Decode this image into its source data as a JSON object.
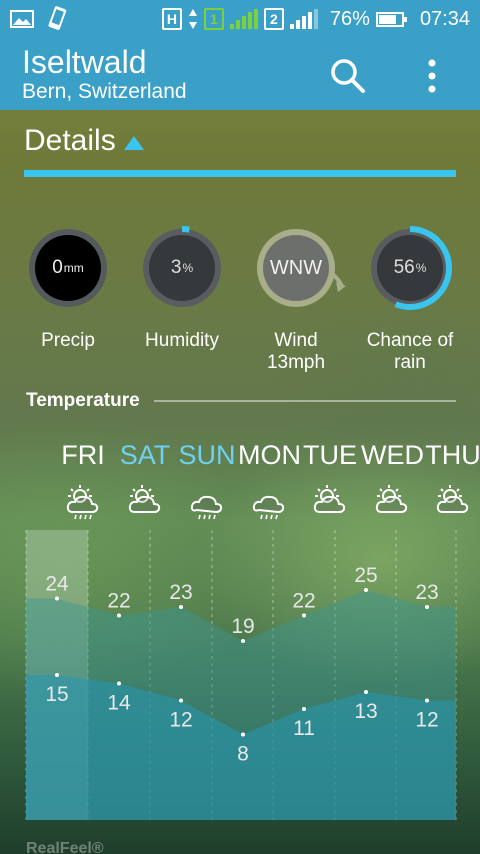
{
  "status": {
    "battery": "76%",
    "time": "07:34",
    "sim1": "1",
    "sim2": "2",
    "net": "H"
  },
  "location": {
    "city": "Iseltwald",
    "region": "Bern, Switzerland"
  },
  "section": {
    "title": "Details"
  },
  "metrics": [
    {
      "label": "Precip",
      "value": "0",
      "unit": "mm",
      "fraction": 0
    },
    {
      "label": "Humidity",
      "value": "3",
      "unit": "%",
      "fraction": 0.03
    },
    {
      "label": "Wind\n13mph",
      "value": "WNW",
      "unit": ""
    },
    {
      "label": "Chance of\nrain",
      "value": "56",
      "unit": "%",
      "fraction": 0.56
    }
  ],
  "temperature": {
    "title": "Temperature",
    "footer": "RealFeel®"
  },
  "days": [
    {
      "name": "FRI",
      "icon": "sun-cloud-rain-icon",
      "high": 24,
      "low": 15,
      "selected": false
    },
    {
      "name": "SAT",
      "icon": "sun-cloud-icon",
      "high": 22,
      "low": 14,
      "selected": true
    },
    {
      "name": "SUN",
      "icon": "cloud-rain-icon",
      "high": 23,
      "low": 12,
      "selected": true
    },
    {
      "name": "MON",
      "icon": "cloud-rain-icon",
      "high": 19,
      "low": 8,
      "selected": false
    },
    {
      "name": "TUE",
      "icon": "sun-cloud-icon",
      "high": 22,
      "low": 11,
      "selected": false
    },
    {
      "name": "WED",
      "icon": "sun-cloud-icon",
      "high": 25,
      "low": 13,
      "selected": false
    },
    {
      "name": "THU",
      "icon": "sun-cloud-icon",
      "high": 23,
      "low": 12,
      "selected": false
    }
  ],
  "colors": {
    "accent": "#3ac5ef",
    "header": "#3aa0c8",
    "selected_day": "#6fd0f0"
  }
}
